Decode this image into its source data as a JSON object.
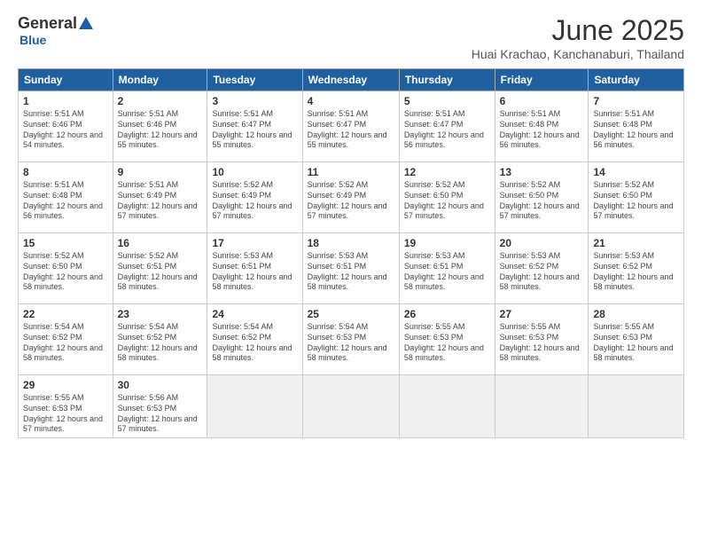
{
  "header": {
    "logo": {
      "general": "General",
      "blue": "Blue"
    },
    "title": "June 2025",
    "location": "Huai Krachao, Kanchanaburi, Thailand"
  },
  "weekdays": [
    "Sunday",
    "Monday",
    "Tuesday",
    "Wednesday",
    "Thursday",
    "Friday",
    "Saturday"
  ],
  "weeks": [
    [
      {
        "day": "1",
        "sunrise": "5:51 AM",
        "sunset": "6:46 PM",
        "daylight": "12 hours and 54 minutes."
      },
      {
        "day": "2",
        "sunrise": "5:51 AM",
        "sunset": "6:46 PM",
        "daylight": "12 hours and 55 minutes."
      },
      {
        "day": "3",
        "sunrise": "5:51 AM",
        "sunset": "6:47 PM",
        "daylight": "12 hours and 55 minutes."
      },
      {
        "day": "4",
        "sunrise": "5:51 AM",
        "sunset": "6:47 PM",
        "daylight": "12 hours and 55 minutes."
      },
      {
        "day": "5",
        "sunrise": "5:51 AM",
        "sunset": "6:47 PM",
        "daylight": "12 hours and 56 minutes."
      },
      {
        "day": "6",
        "sunrise": "5:51 AM",
        "sunset": "6:48 PM",
        "daylight": "12 hours and 56 minutes."
      },
      {
        "day": "7",
        "sunrise": "5:51 AM",
        "sunset": "6:48 PM",
        "daylight": "12 hours and 56 minutes."
      }
    ],
    [
      {
        "day": "8",
        "sunrise": "5:51 AM",
        "sunset": "6:48 PM",
        "daylight": "12 hours and 56 minutes."
      },
      {
        "day": "9",
        "sunrise": "5:51 AM",
        "sunset": "6:49 PM",
        "daylight": "12 hours and 57 minutes."
      },
      {
        "day": "10",
        "sunrise": "5:52 AM",
        "sunset": "6:49 PM",
        "daylight": "12 hours and 57 minutes."
      },
      {
        "day": "11",
        "sunrise": "5:52 AM",
        "sunset": "6:49 PM",
        "daylight": "12 hours and 57 minutes."
      },
      {
        "day": "12",
        "sunrise": "5:52 AM",
        "sunset": "6:50 PM",
        "daylight": "12 hours and 57 minutes."
      },
      {
        "day": "13",
        "sunrise": "5:52 AM",
        "sunset": "6:50 PM",
        "daylight": "12 hours and 57 minutes."
      },
      {
        "day": "14",
        "sunrise": "5:52 AM",
        "sunset": "6:50 PM",
        "daylight": "12 hours and 57 minutes."
      }
    ],
    [
      {
        "day": "15",
        "sunrise": "5:52 AM",
        "sunset": "6:50 PM",
        "daylight": "12 hours and 58 minutes."
      },
      {
        "day": "16",
        "sunrise": "5:52 AM",
        "sunset": "6:51 PM",
        "daylight": "12 hours and 58 minutes."
      },
      {
        "day": "17",
        "sunrise": "5:53 AM",
        "sunset": "6:51 PM",
        "daylight": "12 hours and 58 minutes."
      },
      {
        "day": "18",
        "sunrise": "5:53 AM",
        "sunset": "6:51 PM",
        "daylight": "12 hours and 58 minutes."
      },
      {
        "day": "19",
        "sunrise": "5:53 AM",
        "sunset": "6:51 PM",
        "daylight": "12 hours and 58 minutes."
      },
      {
        "day": "20",
        "sunrise": "5:53 AM",
        "sunset": "6:52 PM",
        "daylight": "12 hours and 58 minutes."
      },
      {
        "day": "21",
        "sunrise": "5:53 AM",
        "sunset": "6:52 PM",
        "daylight": "12 hours and 58 minutes."
      }
    ],
    [
      {
        "day": "22",
        "sunrise": "5:54 AM",
        "sunset": "6:52 PM",
        "daylight": "12 hours and 58 minutes."
      },
      {
        "day": "23",
        "sunrise": "5:54 AM",
        "sunset": "6:52 PM",
        "daylight": "12 hours and 58 minutes."
      },
      {
        "day": "24",
        "sunrise": "5:54 AM",
        "sunset": "6:52 PM",
        "daylight": "12 hours and 58 minutes."
      },
      {
        "day": "25",
        "sunrise": "5:54 AM",
        "sunset": "6:53 PM",
        "daylight": "12 hours and 58 minutes."
      },
      {
        "day": "26",
        "sunrise": "5:55 AM",
        "sunset": "6:53 PM",
        "daylight": "12 hours and 58 minutes."
      },
      {
        "day": "27",
        "sunrise": "5:55 AM",
        "sunset": "6:53 PM",
        "daylight": "12 hours and 58 minutes."
      },
      {
        "day": "28",
        "sunrise": "5:55 AM",
        "sunset": "6:53 PM",
        "daylight": "12 hours and 58 minutes."
      }
    ],
    [
      {
        "day": "29",
        "sunrise": "5:55 AM",
        "sunset": "6:53 PM",
        "daylight": "12 hours and 57 minutes."
      },
      {
        "day": "30",
        "sunrise": "5:56 AM",
        "sunset": "6:53 PM",
        "daylight": "12 hours and 57 minutes."
      },
      null,
      null,
      null,
      null,
      null
    ]
  ],
  "labels": {
    "sunrise_prefix": "Sunrise: ",
    "sunset_prefix": "Sunset: ",
    "daylight_prefix": "Daylight: "
  }
}
